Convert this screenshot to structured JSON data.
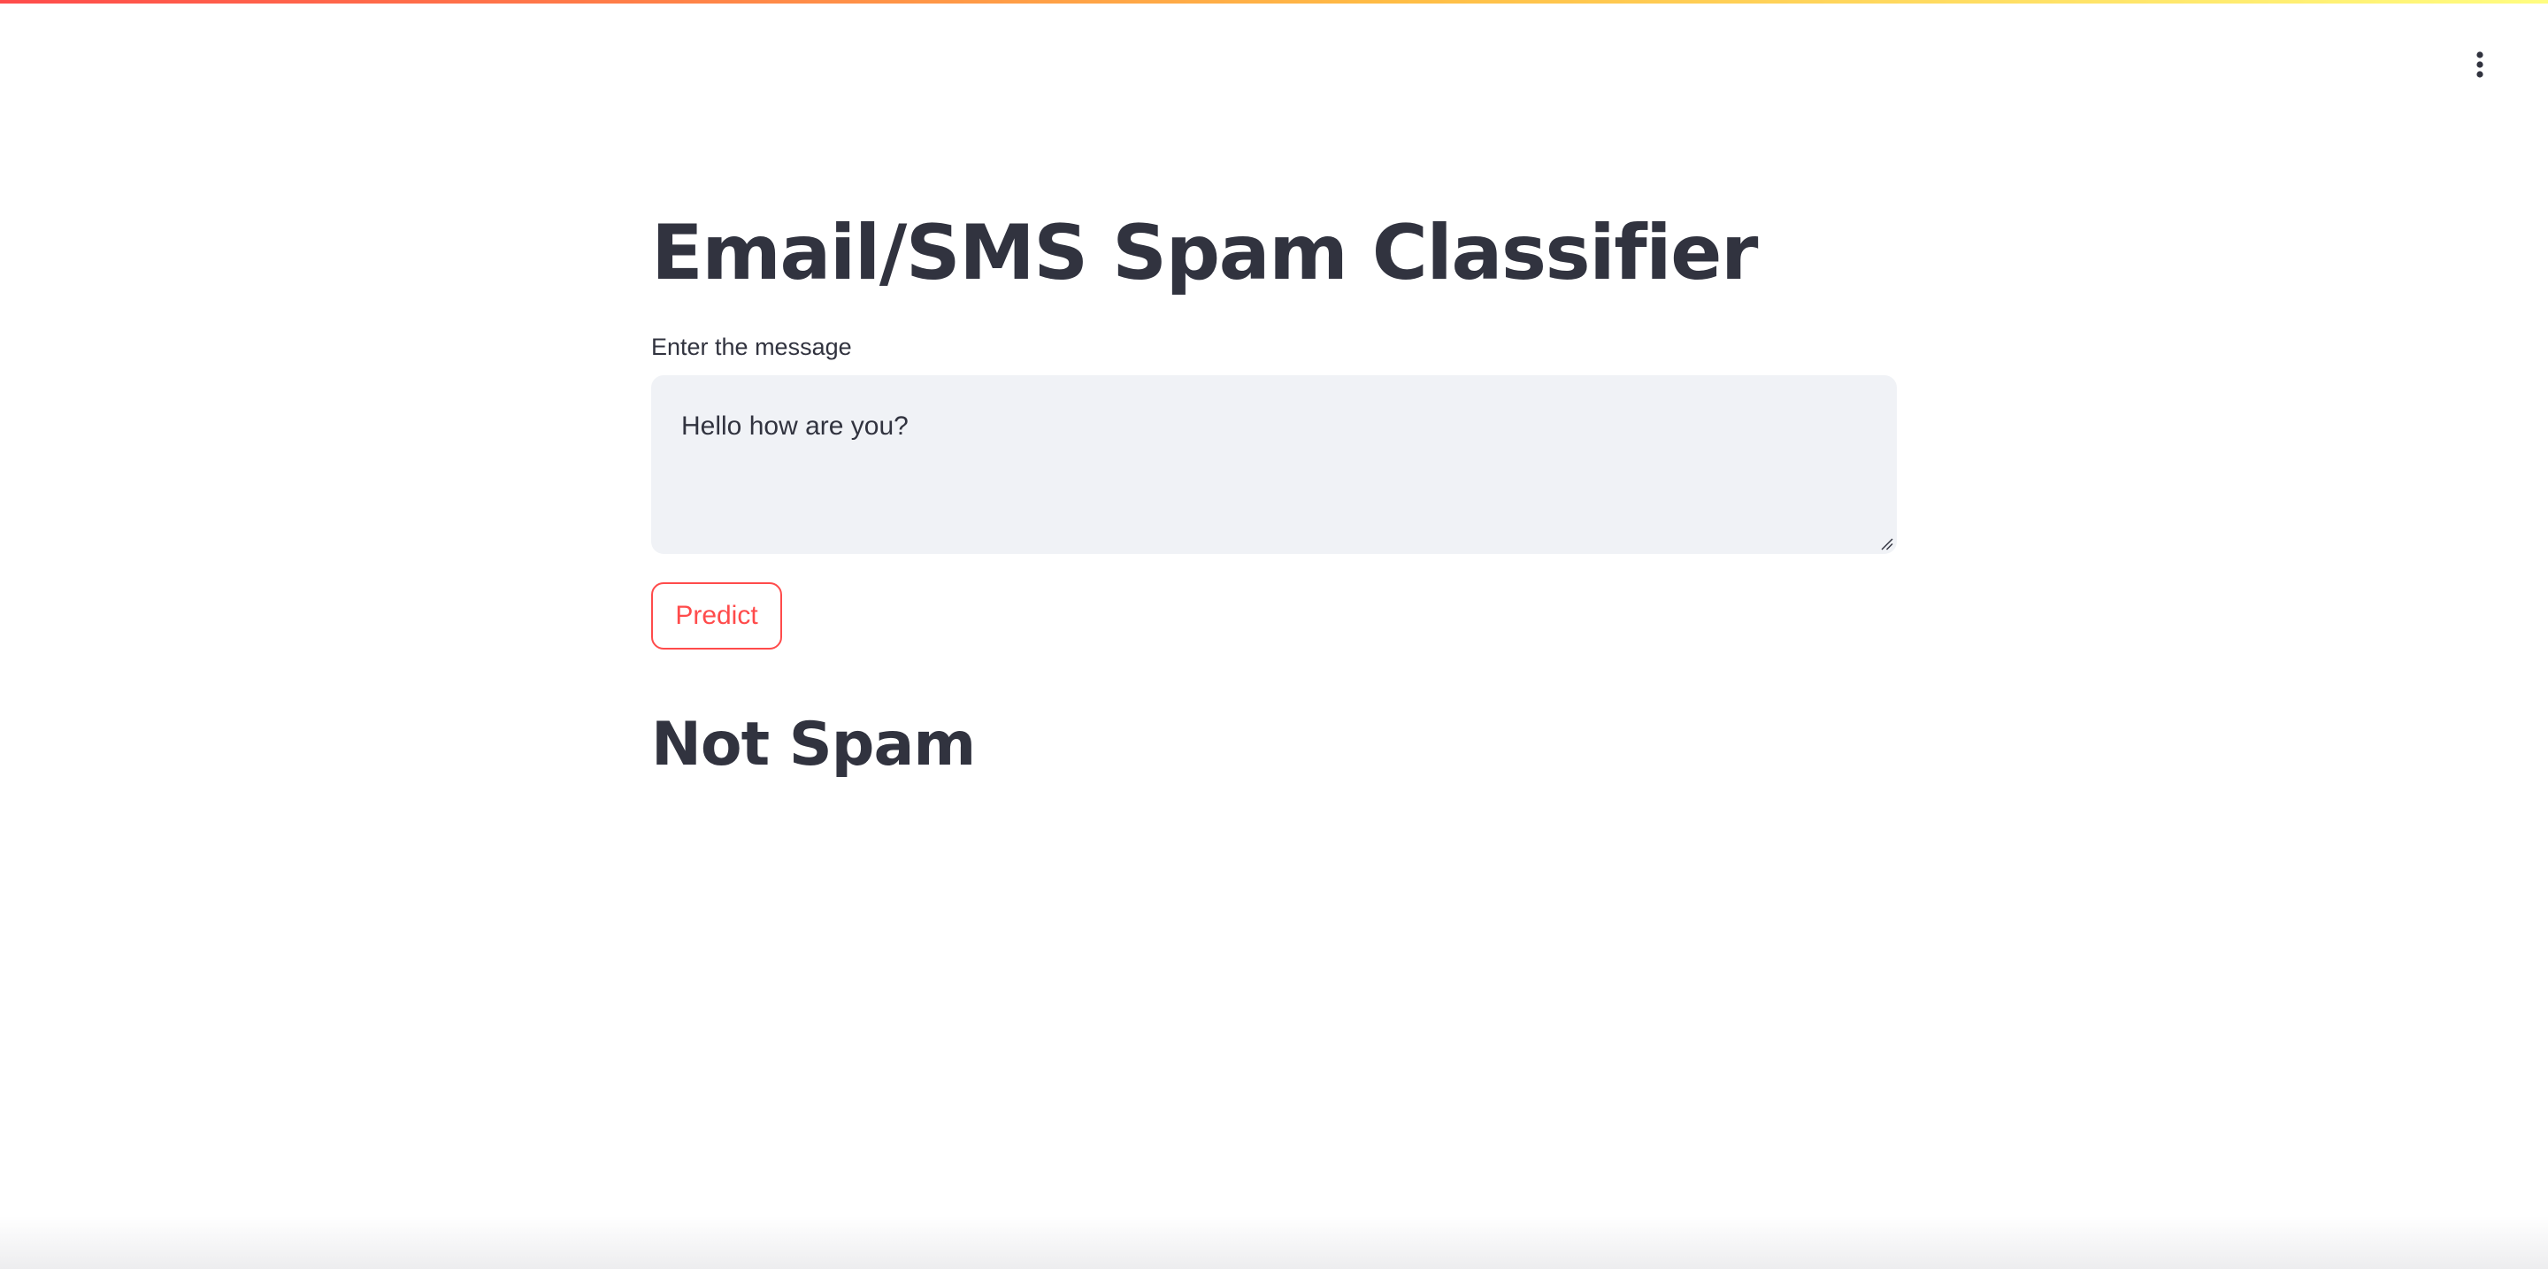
{
  "app": {
    "title": "Email/SMS Spam Classifier",
    "accent_color": "#ff4b4b",
    "text_color": "#31333f",
    "input_background": "#f0f2f6"
  },
  "header": {
    "menu_icon": "vertical-ellipsis-icon"
  },
  "form": {
    "label": "Enter the message",
    "message_value": "Hello how are you?",
    "predict_label": "Predict"
  },
  "result": {
    "text": "Not Spam"
  }
}
